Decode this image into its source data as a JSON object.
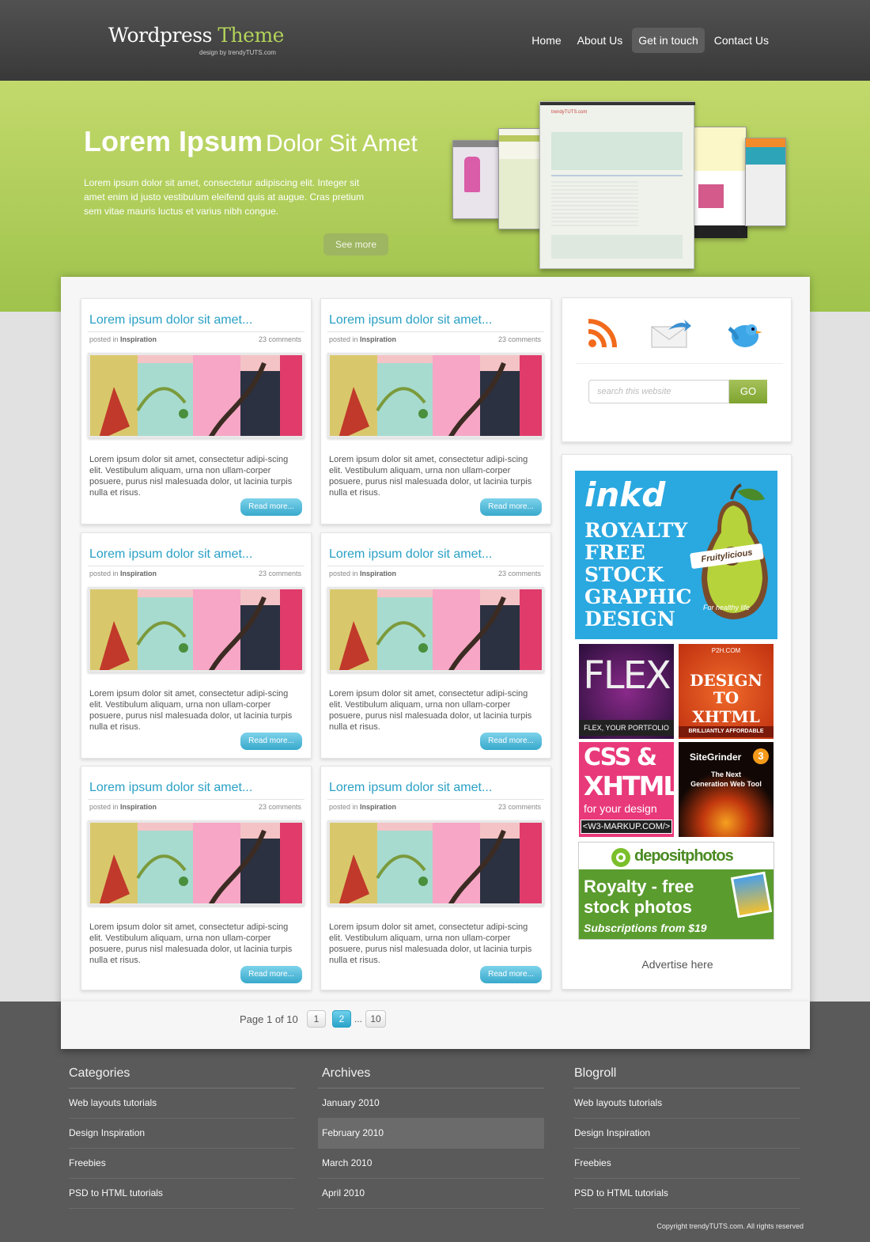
{
  "header": {
    "logo_main": "Wordpress",
    "logo_accent": "Theme",
    "logo_sub": "design by trendyTUTS.com",
    "nav": [
      "Home",
      "About Us",
      "Get in touch",
      "Contact Us"
    ]
  },
  "hero": {
    "title_bold": "Lorem Ipsum",
    "title_light": "Dolor Sit Amet",
    "text": "Lorem ipsum dolor sit amet, consectetur adipiscing elit. Integer sit amet enim id justo vestibulum eleifend quis at augue. Cras pretium sem vitae mauris luctus et varius nibh congue.",
    "button": "See more",
    "mock_brand": "trendyTUTS.com"
  },
  "posts": [
    {
      "title": "Lorem ipsum dolor sit amet...",
      "posted": "posted in",
      "category": "Inspiration",
      "comments": "23 comments",
      "excerpt": "Lorem ipsum dolor sit amet, consectetur adipi-scing elit. Vestibulum aliquam, urna non ullam-corper posuere, purus nisl malesuada dolor, ut lacinia turpis nulla et risus.",
      "read": "Read more..."
    },
    {
      "title": "Lorem ipsum dolor sit amet...",
      "posted": "posted in",
      "category": "Inspiration",
      "comments": "23 comments",
      "excerpt": "Lorem ipsum dolor sit amet, consectetur adipi-scing elit. Vestibulum aliquam, urna non ullam-corper posuere, purus nisl malesuada dolor, ut lacinia turpis nulla et risus.",
      "read": "Read more..."
    },
    {
      "title": "Lorem ipsum dolor sit amet...",
      "posted": "posted in",
      "category": "Inspiration",
      "comments": "23 comments",
      "excerpt": "Lorem ipsum dolor sit amet, consectetur adipi-scing elit. Vestibulum aliquam, urna non ullam-corper posuere, purus nisl malesuada dolor, ut lacinia turpis nulla et risus.",
      "read": "Read more..."
    },
    {
      "title": "Lorem ipsum dolor sit amet...",
      "posted": "posted in",
      "category": "Inspiration",
      "comments": "23 comments",
      "excerpt": "Lorem ipsum dolor sit amet, consectetur adipi-scing elit. Vestibulum aliquam, urna non ullam-corper posuere, purus nisl malesuada dolor, ut lacinia turpis nulla et risus.",
      "read": "Read more..."
    },
    {
      "title": "Lorem ipsum dolor sit amet...",
      "posted": "posted in",
      "category": "Inspiration",
      "comments": "23 comments",
      "excerpt": "Lorem ipsum dolor sit amet, consectetur adipi-scing elit. Vestibulum aliquam, urna non ullam-corper posuere, purus nisl malesuada dolor, ut lacinia turpis nulla et risus.",
      "read": "Read more..."
    },
    {
      "title": "Lorem ipsum dolor sit amet...",
      "posted": "posted in",
      "category": "Inspiration",
      "comments": "23 comments",
      "excerpt": "Lorem ipsum dolor sit amet, consectetur adipi-scing elit. Vestibulum aliquam, urna non ullam-corper posuere, purus nisl malesuada dolor, ut lacinia turpis nulla et risus.",
      "read": "Read more..."
    }
  ],
  "sidebar": {
    "social_icons": [
      "rss-icon",
      "email-icon",
      "twitter-bird-icon"
    ],
    "search_placeholder": "search this website",
    "search_button": "GO",
    "ads": {
      "inkd_brand": "inkd",
      "inkd_lines": [
        "ROYALTY",
        "FREE",
        "STOCK",
        "GRAPHIC",
        "DESIGN"
      ],
      "inkd_badge": "Fruitylicious",
      "inkd_tag": "For healthy life",
      "flex_title": "FLEX",
      "flex_sub": "FLEX, YOUR PORTFOLIO",
      "p2h_top": "P2H.COM",
      "p2h_l1": "DESIGN",
      "p2h_l2": "TO XHTML",
      "p2h_bottom": "BRILLIANTLY AFFORDABLE",
      "w3_l1": "CSS &",
      "w3_l2": "XHTML",
      "w3_l3": "for your design",
      "w3_l4": "<W3-MARKUP.COM/>",
      "sg_brand": "SiteGrinder",
      "sg_num": "3",
      "sg_l1": "The Next",
      "sg_l2": "Generation Web Tool",
      "dp_brand": "depositphotos",
      "dp_l1": "Royalty - free",
      "dp_l2": "stock photos",
      "dp_l3": "Subscriptions from $19"
    },
    "advertise": "Advertise here"
  },
  "pagination": {
    "label": "Page 1 of 10",
    "pages": [
      "1",
      "2",
      "...",
      "10"
    ],
    "current": "2"
  },
  "footer": {
    "columns": [
      {
        "title": "Categories",
        "items": [
          "Web layouts tutorials",
          "Design Inspiration",
          "Freebies",
          "PSD to HTML tutorials"
        ]
      },
      {
        "title": "Archives",
        "items": [
          "January 2010",
          "February 2010",
          "March 2010",
          "April 2010"
        ]
      },
      {
        "title": "Blogroll",
        "items": [
          "Web layouts tutorials",
          "Design Inspiration",
          "Freebies",
          "PSD to HTML tutorials"
        ]
      }
    ],
    "copyright": "Copyright trendyTUTS.com. All rights reserved"
  },
  "colors": {
    "accent_green": "#a4c65a",
    "accent_blue": "#29a0c5",
    "header_bg": "#404040",
    "footer_bg": "#5a5a5a"
  }
}
